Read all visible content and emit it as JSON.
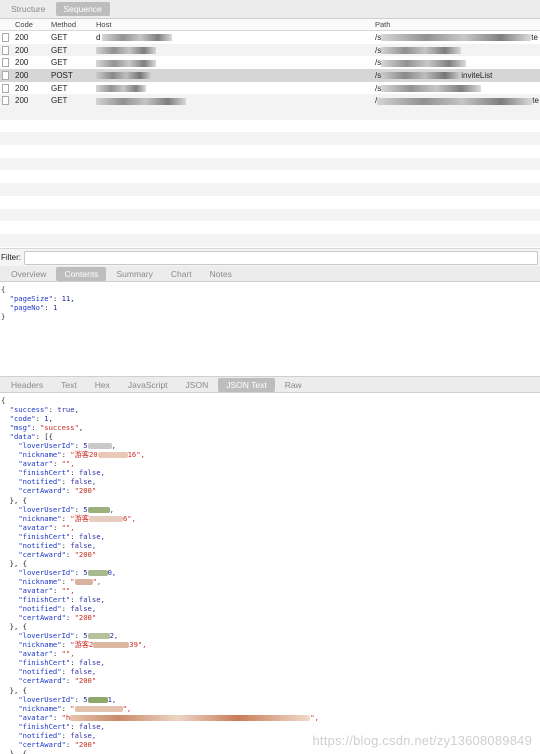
{
  "top_tabs": [
    {
      "label": "Structure",
      "selected": false
    },
    {
      "label": "Sequence",
      "selected": true
    }
  ],
  "table": {
    "headers": [
      "Code",
      "Method",
      "Host",
      "Path"
    ],
    "rows": [
      {
        "code": "200",
        "method": "GET",
        "host_prefix": "d",
        "host_suffix": "",
        "path_prefix": "/s",
        "path_suffix": "te"
      },
      {
        "code": "200",
        "method": "GET",
        "host_prefix": "",
        "host_suffix": "",
        "path_prefix": "/s",
        "path_suffix": ""
      },
      {
        "code": "200",
        "method": "GET",
        "host_prefix": "",
        "host_suffix": "",
        "path_prefix": "/s",
        "path_suffix": ""
      },
      {
        "code": "200",
        "method": "POST",
        "host_prefix": "",
        "host_suffix": "",
        "path_prefix": "/s",
        "path_suffix": "inviteList"
      },
      {
        "code": "200",
        "method": "GET",
        "host_prefix": "",
        "host_suffix": "",
        "path_prefix": "/s",
        "path_suffix": ""
      },
      {
        "code": "200",
        "method": "GET",
        "host_prefix": "",
        "host_suffix": "",
        "path_prefix": "/",
        "path_suffix": "te"
      }
    ]
  },
  "filter": {
    "label": "Filter:",
    "value": ""
  },
  "request_tabs": [
    {
      "label": "Overview",
      "selected": false
    },
    {
      "label": "Contents",
      "selected": true
    },
    {
      "label": "Summary",
      "selected": false
    },
    {
      "label": "Chart",
      "selected": false
    },
    {
      "label": "Notes",
      "selected": false
    }
  ],
  "request_body": {
    "pageSize": "11",
    "pageNo": "1"
  },
  "response_tabs": [
    {
      "label": "Headers",
      "selected": false
    },
    {
      "label": "Text",
      "selected": false
    },
    {
      "label": "Hex",
      "selected": false
    },
    {
      "label": "JavaScript",
      "selected": false
    },
    {
      "label": "JSON",
      "selected": false
    },
    {
      "label": "JSON Text",
      "selected": true
    },
    {
      "label": "Raw",
      "selected": false
    }
  ],
  "response": {
    "success": "true",
    "code": "1",
    "msg": "\"success\"",
    "items": [
      {
        "loverUserId": "5",
        "loverUserId_tail": ",",
        "nickname_a": "\"游客20",
        "nickname_b": "16\",",
        "avatar": "\"\",",
        "finishCert": "false,",
        "notified": "false,",
        "certAward": "\"200\""
      },
      {
        "loverUserId": "5",
        "loverUserId_tail": ",",
        "nickname_a": "\"游客",
        "nickname_b": "6\",",
        "avatar": "\"\",",
        "finishCert": "false,",
        "notified": "false,",
        "certAward": "\"200\""
      },
      {
        "loverUserId": "5",
        "loverUserId_tail": "0,",
        "nickname_a": "\"",
        "nickname_b": "\",",
        "avatar": "\"\",",
        "finishCert": "false,",
        "notified": "false,",
        "certAward": "\"200\""
      },
      {
        "loverUserId": "5",
        "loverUserId_tail": "2,",
        "nickname_a": "\"游客2",
        "nickname_b": "39\",",
        "avatar": "\"\",",
        "finishCert": "false,",
        "notified": "false,",
        "certAward": "\"200\""
      },
      {
        "loverUserId": "5",
        "loverUserId_tail": "1,",
        "nickname_a": "\"",
        "nickname_b": "\",",
        "avatar": "\"h",
        "finishCert": "false,",
        "notified": "false,",
        "certAward": "\"200\""
      }
    ]
  },
  "watermark": "https://blog.csdn.net/zy13608089849",
  "colors": {
    "key": "#1e39c8",
    "string": "#c8281e",
    "tab_selected": "#bdbdbd"
  }
}
